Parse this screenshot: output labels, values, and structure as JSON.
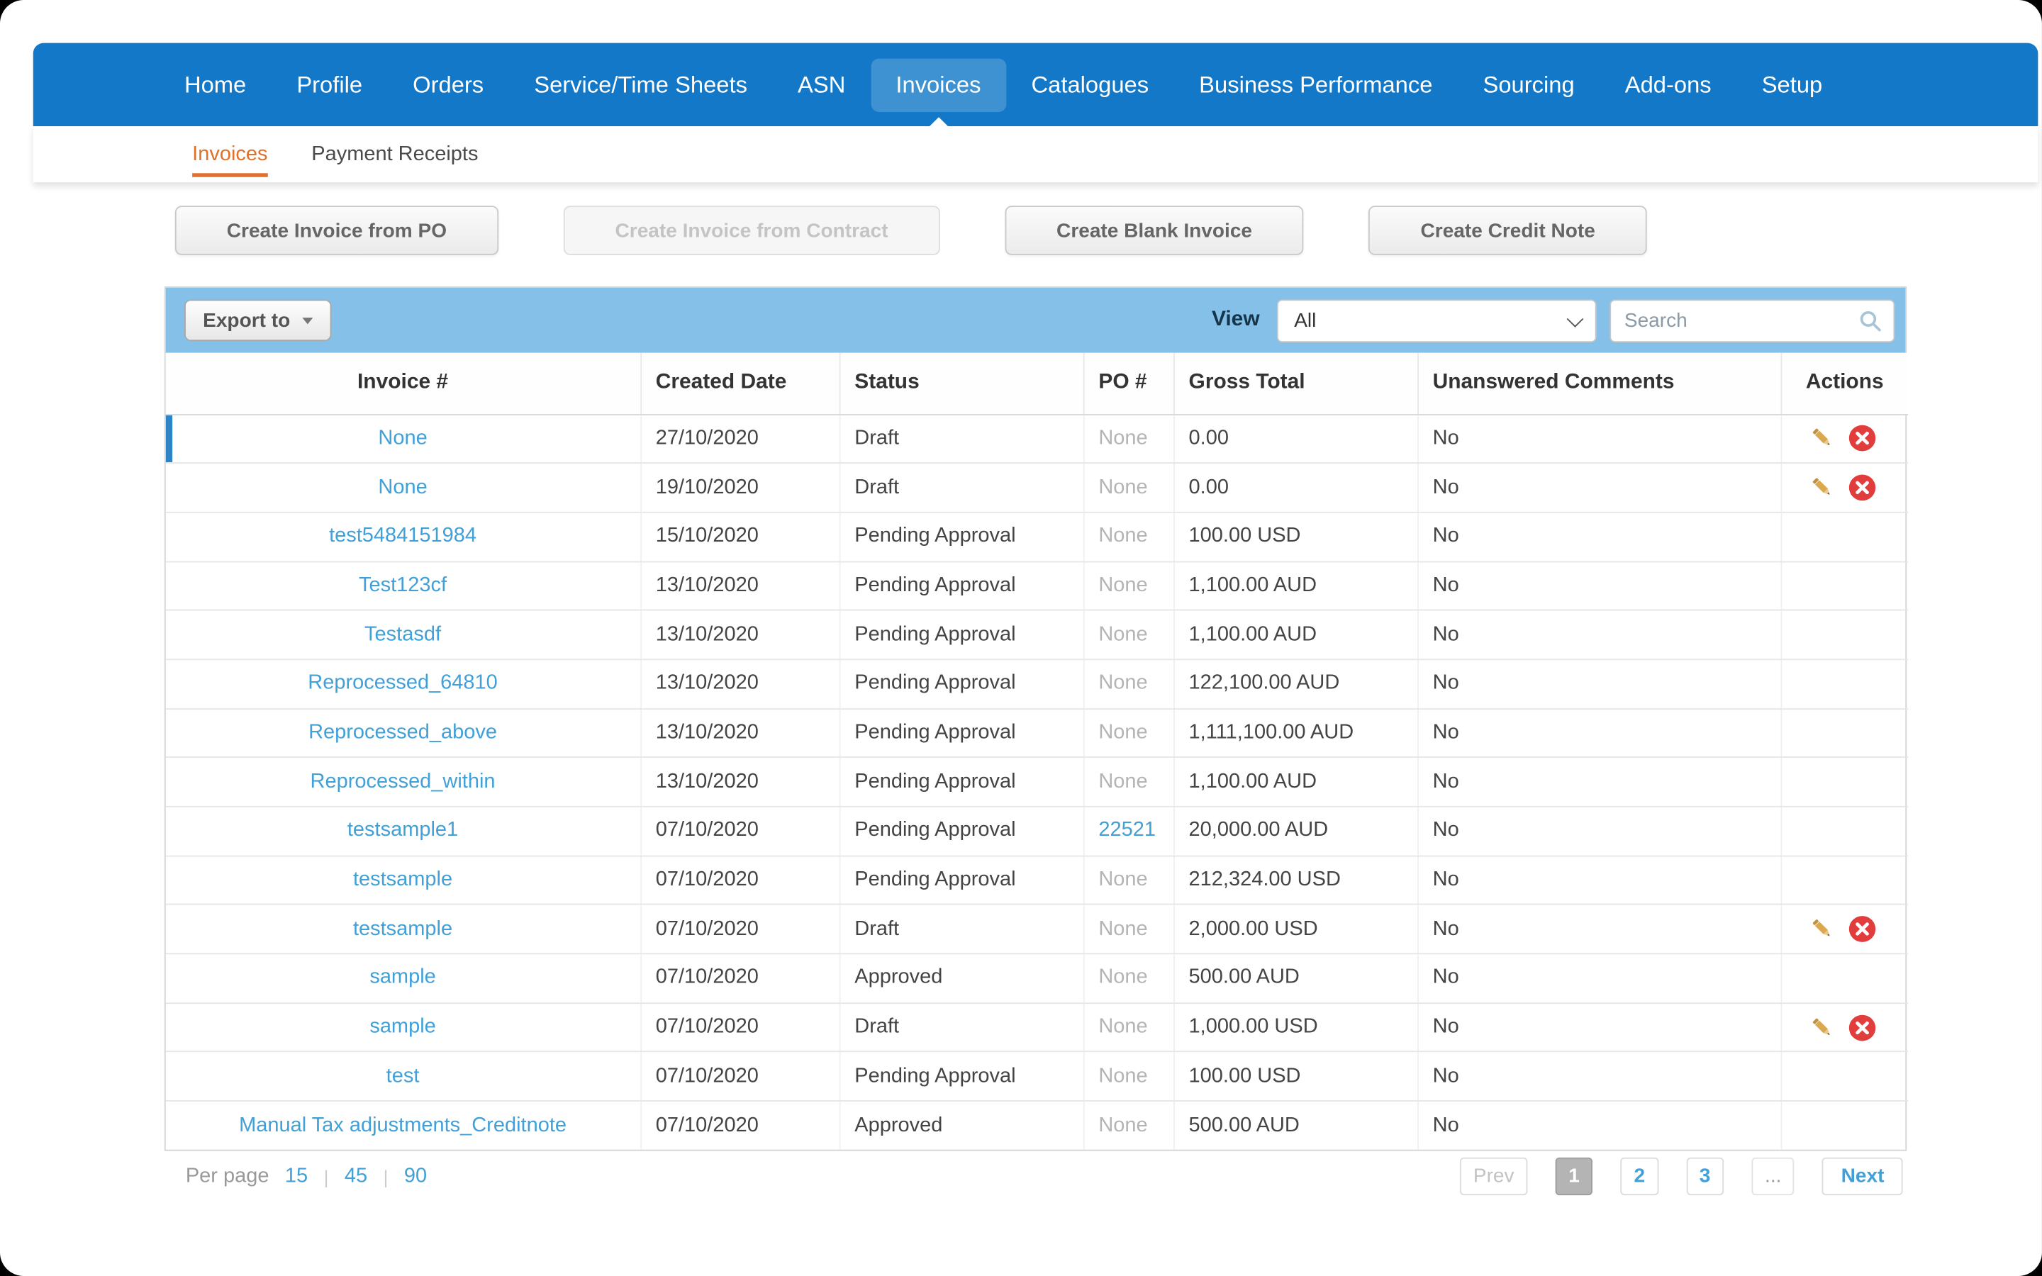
{
  "colors": {
    "nav-blue": "#1478c8",
    "nav-active": "#3f92d2",
    "accent-orange": "#e0702a",
    "toolbar-blue": "#85c0e8",
    "link-blue": "#41a0d8",
    "delete-red": "#e23d3d",
    "pencil-tan": "#dca74f",
    "selected-row-accent": "#2d84c6"
  },
  "icons": {
    "export_caret": "chevron-down-icon",
    "view_caret": "chevron-down-icon",
    "search": "magnifier-icon",
    "edit": "pencil-icon",
    "delete": "x-circle-icon"
  },
  "nav": {
    "items": [
      {
        "label": "Home"
      },
      {
        "label": "Profile"
      },
      {
        "label": "Orders"
      },
      {
        "label": "Service/Time Sheets"
      },
      {
        "label": "ASN"
      },
      {
        "label": "Invoices",
        "active": true
      },
      {
        "label": "Catalogues"
      },
      {
        "label": "Business Performance"
      },
      {
        "label": "Sourcing"
      },
      {
        "label": "Add-ons"
      },
      {
        "label": "Setup"
      }
    ]
  },
  "subnav": {
    "items": [
      {
        "label": "Invoices",
        "active": true
      },
      {
        "label": "Payment Receipts"
      }
    ]
  },
  "actions_bar": {
    "buttons": [
      {
        "label": "Create Invoice from PO",
        "disabled": false
      },
      {
        "label": "Create Invoice from Contract",
        "disabled": true
      },
      {
        "label": "Create Blank Invoice",
        "disabled": false
      },
      {
        "label": "Create Credit Note",
        "disabled": false
      }
    ]
  },
  "table_toolbar": {
    "export_label": "Export to",
    "view_label": "View",
    "view_value": "All",
    "search_placeholder": "Search"
  },
  "table": {
    "columns": [
      "Invoice #",
      "Created Date",
      "Status",
      "PO #",
      "Gross Total",
      "Unanswered Comments",
      "Actions"
    ],
    "rows": [
      {
        "invoice": "None",
        "date": "27/10/2020",
        "status": "Draft",
        "po": "None",
        "po_link": false,
        "gross": "0.00",
        "comments": "No",
        "actions": true,
        "selected": true
      },
      {
        "invoice": "None",
        "date": "19/10/2020",
        "status": "Draft",
        "po": "None",
        "po_link": false,
        "gross": "0.00",
        "comments": "No",
        "actions": true
      },
      {
        "invoice": "test5484151984",
        "date": "15/10/2020",
        "status": "Pending Approval",
        "po": "None",
        "po_link": false,
        "gross": "100.00 USD",
        "comments": "No",
        "actions": false
      },
      {
        "invoice": "Test123cf",
        "date": "13/10/2020",
        "status": "Pending Approval",
        "po": "None",
        "po_link": false,
        "gross": "1,100.00 AUD",
        "comments": "No",
        "actions": false
      },
      {
        "invoice": "Testasdf",
        "date": "13/10/2020",
        "status": "Pending Approval",
        "po": "None",
        "po_link": false,
        "gross": "1,100.00 AUD",
        "comments": "No",
        "actions": false
      },
      {
        "invoice": "Reprocessed_64810",
        "date": "13/10/2020",
        "status": "Pending Approval",
        "po": "None",
        "po_link": false,
        "gross": "122,100.00 AUD",
        "comments": "No",
        "actions": false
      },
      {
        "invoice": "Reprocessed_above",
        "date": "13/10/2020",
        "status": "Pending Approval",
        "po": "None",
        "po_link": false,
        "gross": "1,111,100.00 AUD",
        "comments": "No",
        "actions": false
      },
      {
        "invoice": "Reprocessed_within",
        "date": "13/10/2020",
        "status": "Pending Approval",
        "po": "None",
        "po_link": false,
        "gross": "1,100.00 AUD",
        "comments": "No",
        "actions": false
      },
      {
        "invoice": "testsample1",
        "date": "07/10/2020",
        "status": "Pending Approval",
        "po": "22521",
        "po_link": true,
        "gross": "20,000.00 AUD",
        "comments": "No",
        "actions": false
      },
      {
        "invoice": "testsample",
        "date": "07/10/2020",
        "status": "Pending Approval",
        "po": "None",
        "po_link": false,
        "gross": "212,324.00 USD",
        "comments": "No",
        "actions": false
      },
      {
        "invoice": "testsample",
        "date": "07/10/2020",
        "status": "Draft",
        "po": "None",
        "po_link": false,
        "gross": "2,000.00 USD",
        "comments": "No",
        "actions": true
      },
      {
        "invoice": "sample",
        "date": "07/10/2020",
        "status": "Approved",
        "po": "None",
        "po_link": false,
        "gross": "500.00 AUD",
        "comments": "No",
        "actions": false
      },
      {
        "invoice": "sample",
        "date": "07/10/2020",
        "status": "Draft",
        "po": "None",
        "po_link": false,
        "gross": "1,000.00 USD",
        "comments": "No",
        "actions": true
      },
      {
        "invoice": "test",
        "date": "07/10/2020",
        "status": "Pending Approval",
        "po": "None",
        "po_link": false,
        "gross": "100.00 USD",
        "comments": "No",
        "actions": false
      },
      {
        "invoice": "Manual Tax adjustments_Creditnote",
        "date": "07/10/2020",
        "status": "Approved",
        "po": "None",
        "po_link": false,
        "gross": "500.00 AUD",
        "comments": "No",
        "actions": false
      }
    ]
  },
  "footer": {
    "per_page_label": "Per page",
    "per_page_options": [
      "15",
      "45",
      "90"
    ],
    "pagination": {
      "prev_label": "Prev",
      "pages": [
        "1",
        "2",
        "3"
      ],
      "current_page": "1",
      "ellipsis_label": "...",
      "next_label": "Next"
    }
  }
}
